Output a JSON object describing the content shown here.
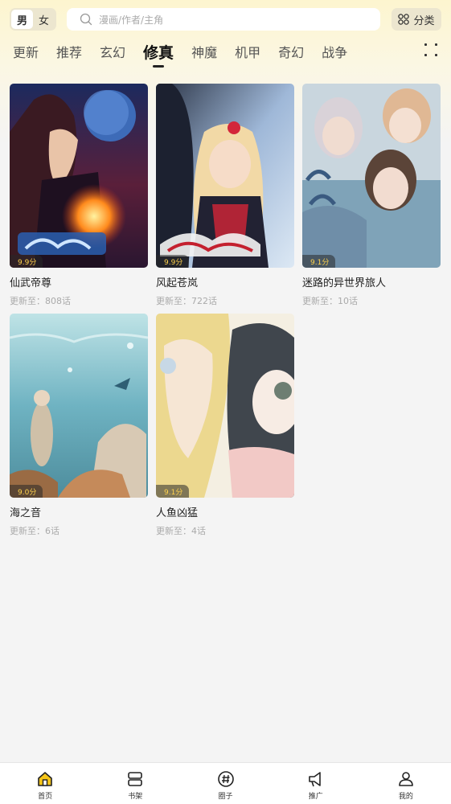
{
  "header": {
    "gender": {
      "male": "男",
      "female": "女",
      "selected": "male"
    },
    "search": {
      "placeholder": "漫画/作者/主角"
    },
    "category_label": "分类"
  },
  "tabs": [
    {
      "label": "更新",
      "active": false
    },
    {
      "label": "推荐",
      "active": false
    },
    {
      "label": "玄幻",
      "active": false
    },
    {
      "label": "修真",
      "active": true
    },
    {
      "label": "神魔",
      "active": false
    },
    {
      "label": "机甲",
      "active": false
    },
    {
      "label": "奇幻",
      "active": false
    },
    {
      "label": "战争",
      "active": false
    }
  ],
  "comics": [
    {
      "title": "仙武帝尊",
      "update": "更新至：808话",
      "rating": "9.9分"
    },
    {
      "title": "风起苍岚",
      "update": "更新至：722话",
      "rating": "9.9分"
    },
    {
      "title": "迷路的异世界旅人",
      "update": "更新至：10话",
      "rating": "9.1分"
    },
    {
      "title": "海之音",
      "update": "更新至：6话",
      "rating": "9.0分"
    },
    {
      "title": "人鱼凶猛",
      "update": "更新至：4话",
      "rating": "9.1分"
    }
  ],
  "bottom_nav": [
    {
      "label": "首页",
      "icon": "home-icon",
      "active": true
    },
    {
      "label": "书架",
      "icon": "bookshelf-icon",
      "active": false
    },
    {
      "label": "圈子",
      "icon": "hashtag-icon",
      "active": false
    },
    {
      "label": "推广",
      "icon": "megaphone-icon",
      "active": false
    },
    {
      "label": "我的",
      "icon": "user-icon",
      "active": false
    }
  ],
  "colors": {
    "accent": "#f5c518",
    "rating_text": "#ffd34d",
    "header_bg": "#fdf5cf"
  }
}
